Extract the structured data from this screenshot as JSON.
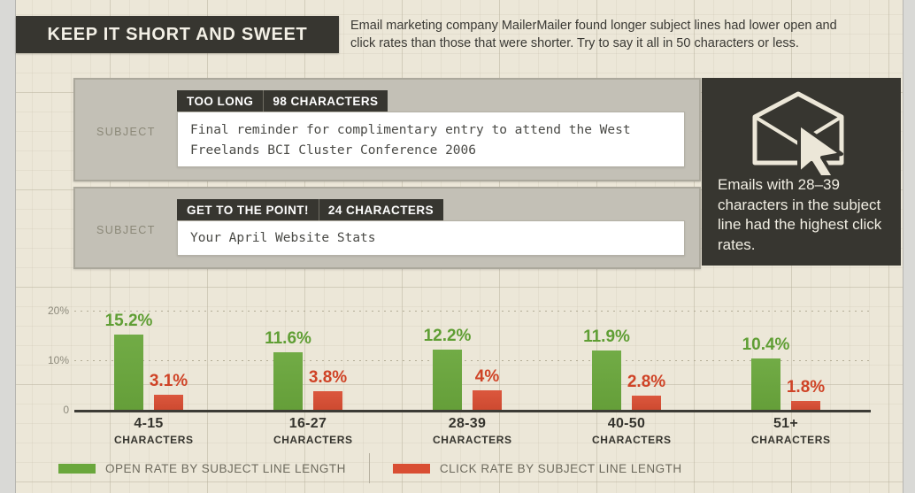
{
  "header": {
    "badge_title": "KEEP IT SHORT AND SWEET",
    "body_text": "Email marketing company MailerMailer found longer subject lines had lower open and click rates than those that were shorter. Try to say it all in 50 characters or less."
  },
  "panels": [
    {
      "subject_label": "SUBJECT",
      "tag_primary": "TOO LONG",
      "tag_count": "98 CHARACTERS",
      "subject_value": "Final reminder for complimentary entry to attend the West Freelands BCI Cluster Conference 2006"
    },
    {
      "subject_label": "SUBJECT",
      "tag_primary": "GET TO THE POINT!",
      "tag_count": "24 CHARACTERS",
      "subject_value": "Your April Website Stats"
    }
  ],
  "callout": {
    "icon": "open-envelope-with-cursor-icon",
    "text": "Emails with 28–39 characters in the subject line had the highest click rates."
  },
  "legend": {
    "open_label": "OPEN RATE BY SUBJECT LINE LENGTH",
    "click_label": "CLICK RATE BY SUBJECT LINE LENGTH"
  },
  "colors": {
    "open": "#6aa73c",
    "click": "#d94e33",
    "dark": "#373630",
    "paper": "#ece7d8",
    "panel_gray": "#c3c0b6"
  },
  "chart_data": {
    "type": "bar",
    "title": "",
    "xlabel": "CHARACTERS",
    "ylabel": "",
    "ylim": [
      0,
      20
    ],
    "grid": true,
    "legend_position": "bottom",
    "ytick_labels": [
      "0",
      "10%",
      "20%"
    ],
    "ytick_values": [
      0,
      10,
      20
    ],
    "categories": [
      "4-15",
      "16-27",
      "28-39",
      "40-50",
      "51+"
    ],
    "category_sublabel": "CHARACTERS",
    "series": [
      {
        "name": "OPEN RATE BY SUBJECT LINE LENGTH",
        "color": "#6aa73c",
        "values": [
          15.2,
          11.6,
          12.2,
          11.9,
          10.4
        ],
        "labels": [
          "15.2%",
          "11.6%",
          "12.2%",
          "11.9%",
          "10.4%"
        ]
      },
      {
        "name": "CLICK RATE BY SUBJECT LINE LENGTH",
        "color": "#d94e33",
        "values": [
          3.1,
          3.8,
          4.0,
          2.8,
          1.8
        ],
        "labels": [
          "3.1%",
          "3.8%",
          "4%",
          "2.8%",
          "1.8%"
        ]
      }
    ]
  }
}
